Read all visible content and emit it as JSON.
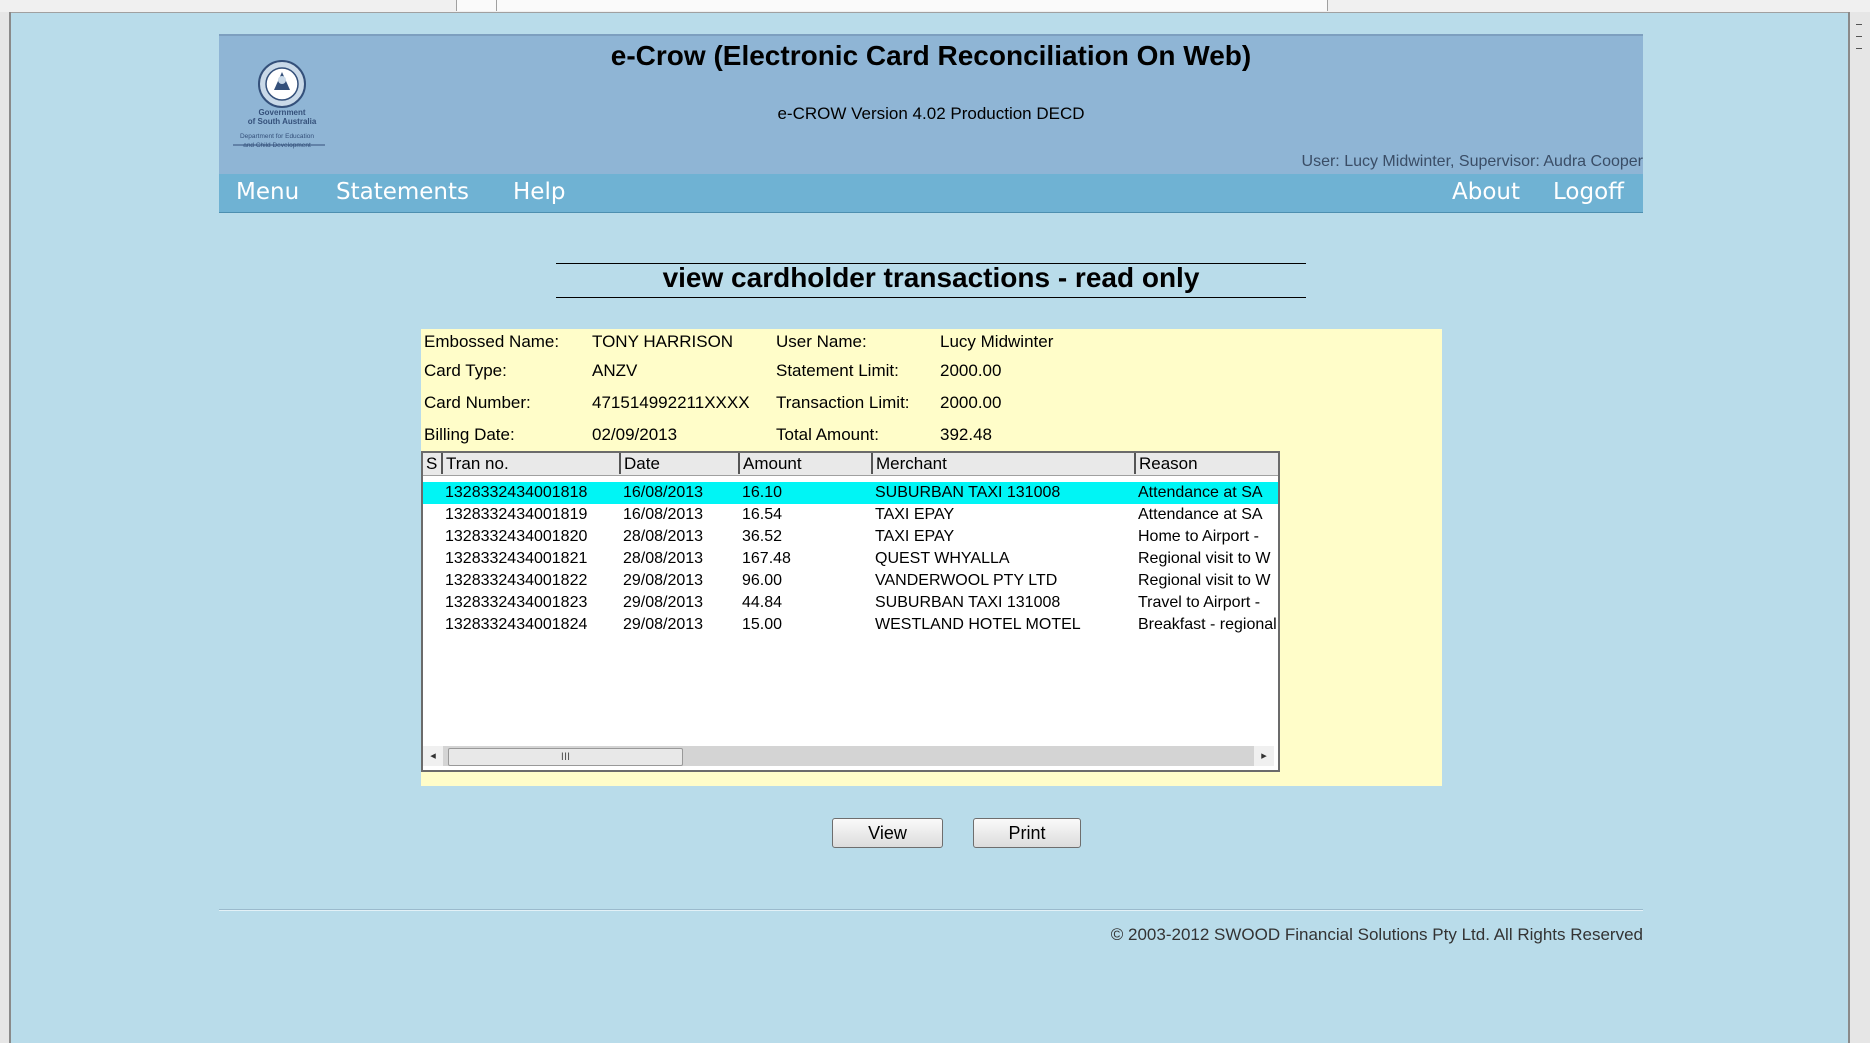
{
  "header": {
    "title": "e-Crow (Electronic Card Reconciliation On Web)",
    "version": "e-CROW Version 4.02 Production DECD",
    "user_info": "User: Lucy Midwinter, Supervisor: Audra Cooper",
    "logo": {
      "line1": "Government",
      "line2": "of South Australia",
      "line3": "Department for Education",
      "line4": "and Child Development"
    }
  },
  "nav": {
    "left": [
      "Menu",
      "Statements",
      "Help"
    ],
    "right": [
      "About",
      "Logoff"
    ]
  },
  "page": {
    "heading": "view cardholder transactions - read only"
  },
  "card": {
    "embossed_name_label": "Embossed Name:",
    "embossed_name": "TONY HARRISON",
    "card_type_label": "Card Type:",
    "card_type": "ANZV",
    "card_number_label": "Card Number:",
    "card_number": "471514992211XXXX",
    "billing_date_label": "Billing Date:",
    "billing_date": "02/09/2013",
    "user_name_label": "User Name:",
    "user_name": "Lucy Midwinter",
    "statement_limit_label": "Statement Limit:",
    "statement_limit": "2000.00",
    "transaction_limit_label": "Transaction Limit:",
    "transaction_limit": "2000.00",
    "total_amount_label": "Total Amount:",
    "total_amount": "392.48"
  },
  "table": {
    "columns": [
      "S",
      "Tran no.",
      "Date",
      "Amount",
      "Merchant",
      "Reason"
    ],
    "rows": [
      {
        "s": "",
        "tran": "1328332434001818",
        "date": "16/08/2013",
        "amount": "16.10",
        "merchant": "SUBURBAN TAXI 131008",
        "reason": "Attendance at SA"
      },
      {
        "s": "",
        "tran": "1328332434001819",
        "date": "16/08/2013",
        "amount": "16.54",
        "merchant": "TAXI EPAY",
        "reason": "Attendance at SA"
      },
      {
        "s": "",
        "tran": "1328332434001820",
        "date": "28/08/2013",
        "amount": "36.52",
        "merchant": "TAXI EPAY",
        "reason": "Home to Airport -"
      },
      {
        "s": "",
        "tran": "1328332434001821",
        "date": "28/08/2013",
        "amount": "167.48",
        "merchant": "QUEST WHYALLA",
        "reason": "Regional visit to W"
      },
      {
        "s": "",
        "tran": "1328332434001822",
        "date": "29/08/2013",
        "amount": "96.00",
        "merchant": "VANDERWOOL PTY LTD",
        "reason": "Regional visit to W"
      },
      {
        "s": "",
        "tran": "1328332434001823",
        "date": "29/08/2013",
        "amount": "44.84",
        "merchant": "SUBURBAN TAXI 131008",
        "reason": "Travel to Airport -"
      },
      {
        "s": "",
        "tran": "1328332434001824",
        "date": "29/08/2013",
        "amount": "15.00",
        "merchant": "WESTLAND HOTEL MOTEL",
        "reason": "Breakfast - regional"
      }
    ],
    "selected_row": 0,
    "scroll_left": "◂",
    "scroll_right": "▸",
    "scroll_grip": "III"
  },
  "buttons": {
    "view": "View",
    "print": "Print"
  },
  "footer": {
    "copyright": "© 2003-2012 SWOOD Financial Solutions Pty Ltd. All Rights Reserved"
  },
  "colors": {
    "background": "#b9dcea",
    "banner": "#8fb5d5",
    "nav": "#6fb2d3",
    "panel": "#fffdc9",
    "selected_row": "#00f5f5"
  }
}
